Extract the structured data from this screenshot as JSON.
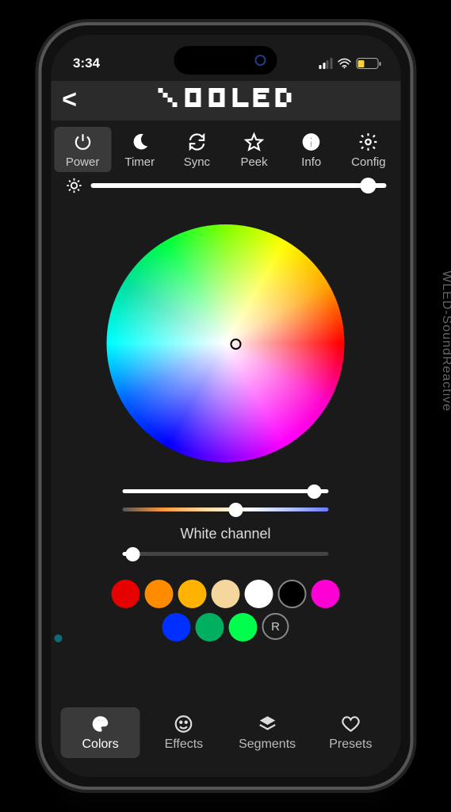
{
  "status": {
    "time": "3:34"
  },
  "header": {
    "title": "WLED"
  },
  "toolbar": {
    "power": "Power",
    "timer": "Timer",
    "sync": "Sync",
    "peek": "Peek",
    "info": "Info",
    "config": "Config"
  },
  "brightness": {
    "value": 94
  },
  "sliders": {
    "value_pct": 93,
    "temp_pct": 55,
    "white_label": "White channel",
    "white_pct": 5
  },
  "swatches": {
    "row1": [
      "#e60000",
      "#ff8c00",
      "#ffb300",
      "#f5d79e",
      "#ffffff",
      "black"
    ],
    "row2": [
      "#ff00d4",
      "#0030ff",
      "#00b060",
      "#00ff4c"
    ],
    "random_label": "R"
  },
  "bottom_nav": {
    "colors": "Colors",
    "effects": "Effects",
    "segments": "Segments",
    "presets": "Presets"
  },
  "watermark": "WLED-SoundReactive"
}
